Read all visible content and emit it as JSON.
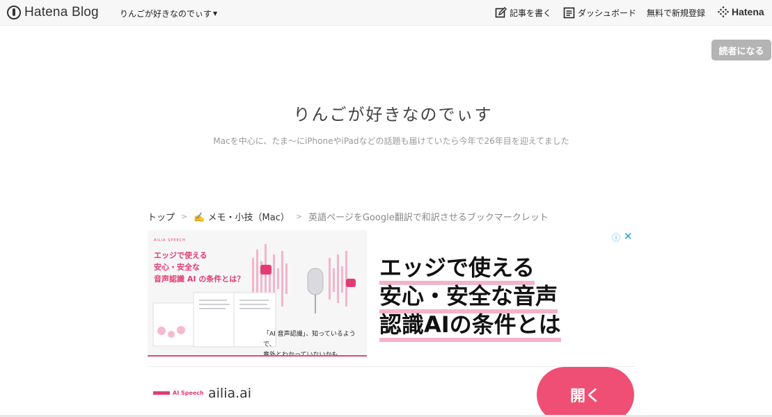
{
  "topbar": {
    "brand": "Hatena Blog",
    "blog_switch": "りんごが好きなのでぃす",
    "write_label": "記事を書く",
    "dashboard_label": "ダッシュボード",
    "signup_label": "無料で新規登録",
    "hatena_label": "Hatena"
  },
  "subscribe_label": "読者になる",
  "header": {
    "title": "りんごが好きなのでぃす",
    "description": "Macを中心に、たま〜にiPhoneやiPadなどの話題も届けていたら今年で26年目を迎えてました"
  },
  "breadcrumb": {
    "home": "トップ",
    "category": "✍️ メモ・小技（Mac）",
    "current": "英語ページをGoogle翻訳で和訳させるブックマークレット",
    "sep": ">"
  },
  "ad": {
    "image_brand": "AILIA SPEECH",
    "image_title": [
      "エッジで使える",
      "安心・安全な",
      "音声認識 AI の条件とは？"
    ],
    "image_caption": [
      "「AI 音声認識」、知っているようで、",
      "意外とわかっていないかも"
    ],
    "headline": [
      "エッジで使える",
      "安心・安全な音声",
      "認識AIの条件とは"
    ],
    "info_icon": "ⓘ",
    "close_icon": "✕",
    "logo_text": "AI Speech",
    "domain": "ailia.ai",
    "open_label": "開く",
    "accent_color": "#ef4f74"
  }
}
